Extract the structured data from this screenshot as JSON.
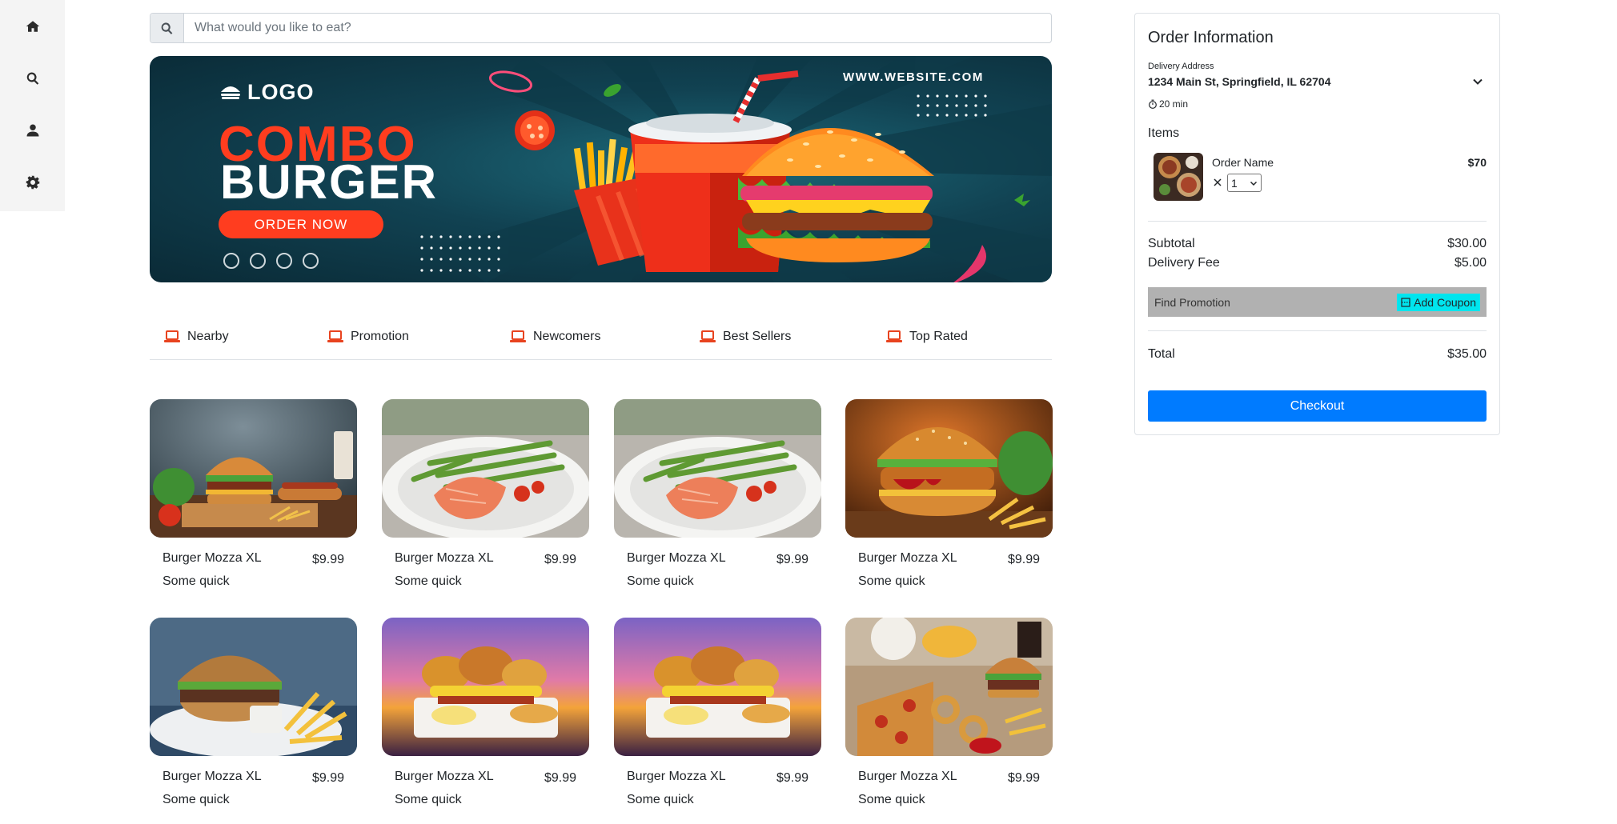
{
  "sidebar": {
    "items": [
      {
        "icon": "home-icon"
      },
      {
        "icon": "search-icon"
      },
      {
        "icon": "user-icon"
      },
      {
        "icon": "gear-icon"
      }
    ]
  },
  "search": {
    "placeholder": "What would you like to eat?",
    "value": ""
  },
  "banner": {
    "logo": "LOGO",
    "website": "WWW.WEBSITE.COM",
    "headline_1": "COMBO",
    "headline_2": "BURGER",
    "cta": "ORDER NOW"
  },
  "categories": [
    {
      "label": "Nearby",
      "icon": "laptop-icon"
    },
    {
      "label": "Promotion",
      "icon": "laptop-icon"
    },
    {
      "label": "Newcomers",
      "icon": "laptop-icon"
    },
    {
      "label": "Best Sellers",
      "icon": "laptop-icon"
    },
    {
      "label": "Top Rated",
      "icon": "laptop-icon"
    }
  ],
  "foods": [
    {
      "name": "Burger Mozza XL",
      "price": "$9.99",
      "desc": "Some quick",
      "image": "burger-table"
    },
    {
      "name": "Burger Mozza XL",
      "price": "$9.99",
      "desc": "Some quick",
      "image": "salmon-asparagus"
    },
    {
      "name": "Burger Mozza XL",
      "price": "$9.99",
      "desc": "Some quick",
      "image": "salmon-asparagus"
    },
    {
      "name": "Burger Mozza XL",
      "price": "$9.99",
      "desc": "Some quick",
      "image": "chicken-burger"
    },
    {
      "name": "Burger Mozza XL",
      "price": "$9.99",
      "desc": "Some quick",
      "image": "burger-fries-plate"
    },
    {
      "name": "Burger Mozza XL",
      "price": "$9.99",
      "desc": "Some quick",
      "image": "breakfast-sunset"
    },
    {
      "name": "Burger Mozza XL",
      "price": "$9.99",
      "desc": "Some quick",
      "image": "breakfast-sunset"
    },
    {
      "name": "Burger Mozza XL",
      "price": "$9.99",
      "desc": "Some quick",
      "image": "fast-food-spread"
    }
  ],
  "order": {
    "title": "Order Information",
    "address_label": "Delivery Address",
    "address": "1234 Main St, Springfield, IL 62704",
    "time": "20 min",
    "items_label": "Items",
    "item": {
      "name": "Order Name",
      "price": "$70",
      "qty": "1"
    },
    "subtotal_label": "Subtotal",
    "subtotal": "$30.00",
    "delivery_label": "Delivery Fee",
    "delivery": "$5.00",
    "promo_label": "Find Promotion",
    "coupon_label": "Add Coupon",
    "total_label": "Total",
    "total": "$35.00",
    "checkout": "Checkout"
  },
  "colors": {
    "accent": "#007bff",
    "category_icon": "#e8431f",
    "coupon": "#00e5ee",
    "banner_red": "#ff3d1f",
    "banner_bg": "#114252"
  }
}
